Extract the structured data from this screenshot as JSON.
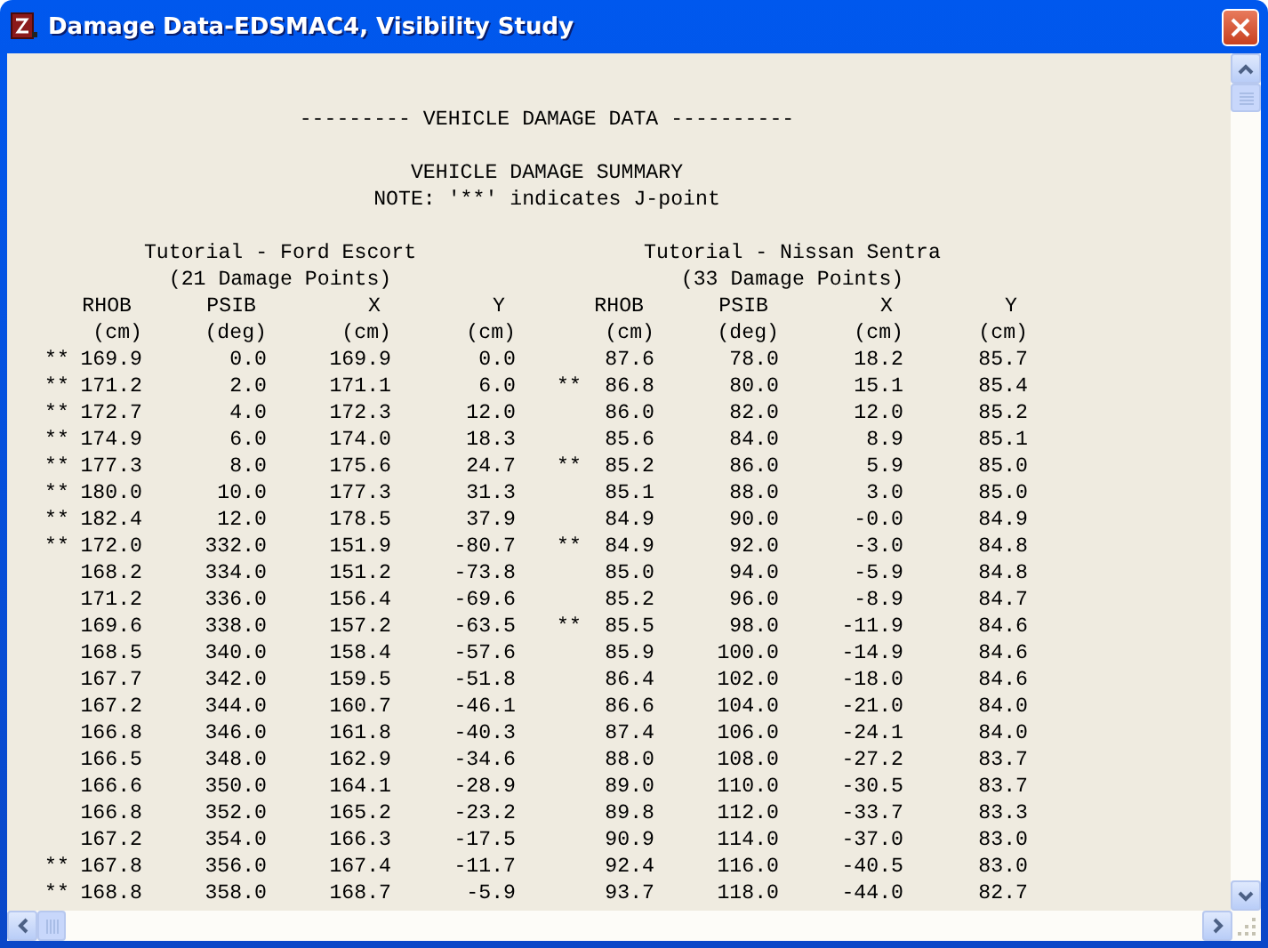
{
  "window": {
    "title": "Damage Data-EDSMAC4, Visibility Study"
  },
  "report": {
    "banner": "--------- VEHICLE DAMAGE DATA ----------",
    "heading": "VEHICLE DAMAGE SUMMARY",
    "note": "NOTE: '**' indicates J-point",
    "vehicles": [
      {
        "title": "Tutorial - Ford Escort",
        "points": "(21 Damage Points)",
        "columns": [
          {
            "name": "RHOB",
            "unit": "(cm)"
          },
          {
            "name": "PSIB",
            "unit": "(deg)"
          },
          {
            "name": "X",
            "unit": "(cm)"
          },
          {
            "name": "Y",
            "unit": "(cm)"
          }
        ],
        "rows": [
          {
            "flag": "**",
            "values": [
              "169.9",
              "0.0",
              "169.9",
              "0.0"
            ]
          },
          {
            "flag": "**",
            "values": [
              "171.2",
              "2.0",
              "171.1",
              "6.0"
            ]
          },
          {
            "flag": "**",
            "values": [
              "172.7",
              "4.0",
              "172.3",
              "12.0"
            ]
          },
          {
            "flag": "**",
            "values": [
              "174.9",
              "6.0",
              "174.0",
              "18.3"
            ]
          },
          {
            "flag": "**",
            "values": [
              "177.3",
              "8.0",
              "175.6",
              "24.7"
            ]
          },
          {
            "flag": "**",
            "values": [
              "180.0",
              "10.0",
              "177.3",
              "31.3"
            ]
          },
          {
            "flag": "**",
            "values": [
              "182.4",
              "12.0",
              "178.5",
              "37.9"
            ]
          },
          {
            "flag": "**",
            "values": [
              "172.0",
              "332.0",
              "151.9",
              "-80.7"
            ]
          },
          {
            "values": [
              "168.2",
              "334.0",
              "151.2",
              "-73.8"
            ]
          },
          {
            "values": [
              "171.2",
              "336.0",
              "156.4",
              "-69.6"
            ]
          },
          {
            "values": [
              "169.6",
              "338.0",
              "157.2",
              "-63.5"
            ]
          },
          {
            "values": [
              "168.5",
              "340.0",
              "158.4",
              "-57.6"
            ]
          },
          {
            "values": [
              "167.7",
              "342.0",
              "159.5",
              "-51.8"
            ]
          },
          {
            "values": [
              "167.2",
              "344.0",
              "160.7",
              "-46.1"
            ]
          },
          {
            "values": [
              "166.8",
              "346.0",
              "161.8",
              "-40.3"
            ]
          },
          {
            "values": [
              "166.5",
              "348.0",
              "162.9",
              "-34.6"
            ]
          },
          {
            "values": [
              "166.6",
              "350.0",
              "164.1",
              "-28.9"
            ]
          },
          {
            "values": [
              "166.8",
              "352.0",
              "165.2",
              "-23.2"
            ]
          },
          {
            "values": [
              "167.2",
              "354.0",
              "166.3",
              "-17.5"
            ]
          },
          {
            "flag": "**",
            "values": [
              "167.8",
              "356.0",
              "167.4",
              "-11.7"
            ]
          },
          {
            "flag": "**",
            "values": [
              "168.8",
              "358.0",
              "168.7",
              "-5.9"
            ]
          }
        ]
      },
      {
        "title": "Tutorial - Nissan Sentra",
        "points": "(33 Damage Points)",
        "columns": [
          {
            "name": "RHOB",
            "unit": "(cm)"
          },
          {
            "name": "PSIB",
            "unit": "(deg)"
          },
          {
            "name": "X",
            "unit": "(cm)"
          },
          {
            "name": "Y",
            "unit": "(cm)"
          }
        ],
        "rows": [
          {
            "values": [
              "87.6",
              "78.0",
              "18.2",
              "85.7"
            ]
          },
          {
            "flag": "**",
            "values": [
              "86.8",
              "80.0",
              "15.1",
              "85.4"
            ]
          },
          {
            "values": [
              "86.0",
              "82.0",
              "12.0",
              "85.2"
            ]
          },
          {
            "values": [
              "85.6",
              "84.0",
              "8.9",
              "85.1"
            ]
          },
          {
            "flag": "**",
            "values": [
              "85.2",
              "86.0",
              "5.9",
              "85.0"
            ]
          },
          {
            "values": [
              "85.1",
              "88.0",
              "3.0",
              "85.0"
            ]
          },
          {
            "values": [
              "84.9",
              "90.0",
              "-0.0",
              "84.9"
            ]
          },
          {
            "flag": "**",
            "values": [
              "84.9",
              "92.0",
              "-3.0",
              "84.8"
            ]
          },
          {
            "values": [
              "85.0",
              "94.0",
              "-5.9",
              "84.8"
            ]
          },
          {
            "values": [
              "85.2",
              "96.0",
              "-8.9",
              "84.7"
            ]
          },
          {
            "flag": "**",
            "values": [
              "85.5",
              "98.0",
              "-11.9",
              "84.6"
            ]
          },
          {
            "values": [
              "85.9",
              "100.0",
              "-14.9",
              "84.6"
            ]
          },
          {
            "values": [
              "86.4",
              "102.0",
              "-18.0",
              "84.6"
            ]
          },
          {
            "values": [
              "86.6",
              "104.0",
              "-21.0",
              "84.0"
            ]
          },
          {
            "values": [
              "87.4",
              "106.0",
              "-24.1",
              "84.0"
            ]
          },
          {
            "values": [
              "88.0",
              "108.0",
              "-27.2",
              "83.7"
            ]
          },
          {
            "values": [
              "89.0",
              "110.0",
              "-30.5",
              "83.7"
            ]
          },
          {
            "values": [
              "89.8",
              "112.0",
              "-33.7",
              "83.3"
            ]
          },
          {
            "values": [
              "90.9",
              "114.0",
              "-37.0",
              "83.0"
            ]
          },
          {
            "values": [
              "92.4",
              "116.0",
              "-40.5",
              "83.0"
            ]
          },
          {
            "values": [
              "93.7",
              "118.0",
              "-44.0",
              "82.7"
            ]
          }
        ]
      }
    ]
  }
}
